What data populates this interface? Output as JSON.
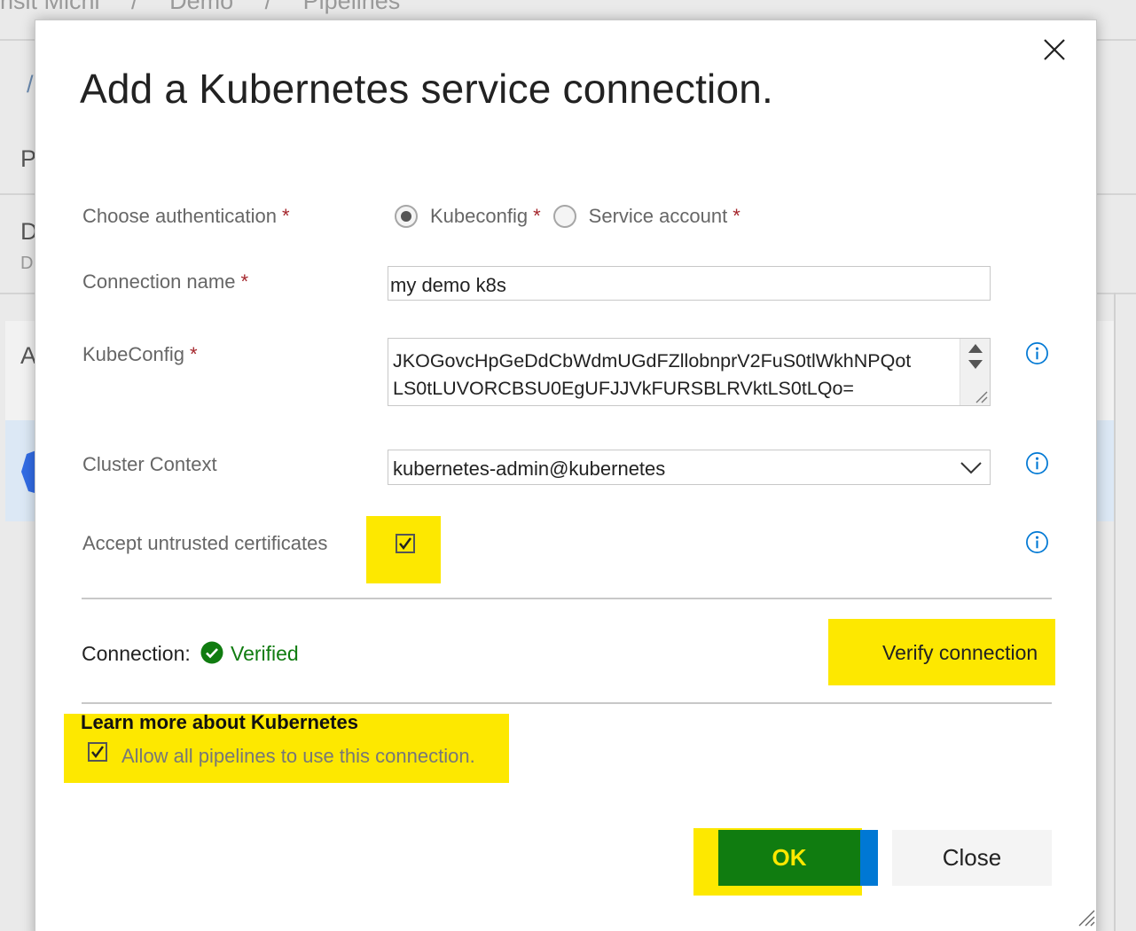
{
  "background": {
    "breadcrumbs": [
      "nsit Michi",
      "/",
      "Demo",
      "/",
      "Pipelines"
    ],
    "letters": [
      "/",
      "P",
      "D",
      "D",
      "A"
    ]
  },
  "dialog": {
    "title": "Add a Kubernetes service connection.",
    "close_icon": "close-icon",
    "authentication": {
      "label": "Choose authentication",
      "required_mark": "*",
      "options": [
        {
          "label": "Kubeconfig",
          "required_mark": "*",
          "selected": true
        },
        {
          "label": "Service account",
          "required_mark": "*",
          "selected": false
        }
      ]
    },
    "connection_name": {
      "label": "Connection name",
      "required_mark": "*",
      "value": "my demo k8s"
    },
    "kubeconfig": {
      "label": "KubeConfig",
      "required_mark": "*",
      "lines": [
        "JKOGovcHpGeDdCbWdmUGdFZllobnprV2FuS0tlWkhNPQot",
        "LS0tLUVORCBSU0EgUFJJVkFURSBLRVktLS0tLQo="
      ]
    },
    "cluster_context": {
      "label": "Cluster Context",
      "value": "kubernetes-admin@kubernetes"
    },
    "accept_untrusted": {
      "label": "Accept untrusted certificates",
      "checked": true
    },
    "connection_status": {
      "label": "Connection:",
      "value": "Verified"
    },
    "verify_button": "Verify connection",
    "learn_more": "Learn more about Kubernetes",
    "allow_all": {
      "label": "Allow all pipelines to use this connection.",
      "checked": true
    },
    "ok_button": "OK",
    "close_button": "Close"
  },
  "colors": {
    "highlight": "#fde800",
    "ok_green": "#107c10",
    "accent_blue": "#0078d4",
    "verified_green": "#107c10",
    "required_red": "#a4262c"
  }
}
